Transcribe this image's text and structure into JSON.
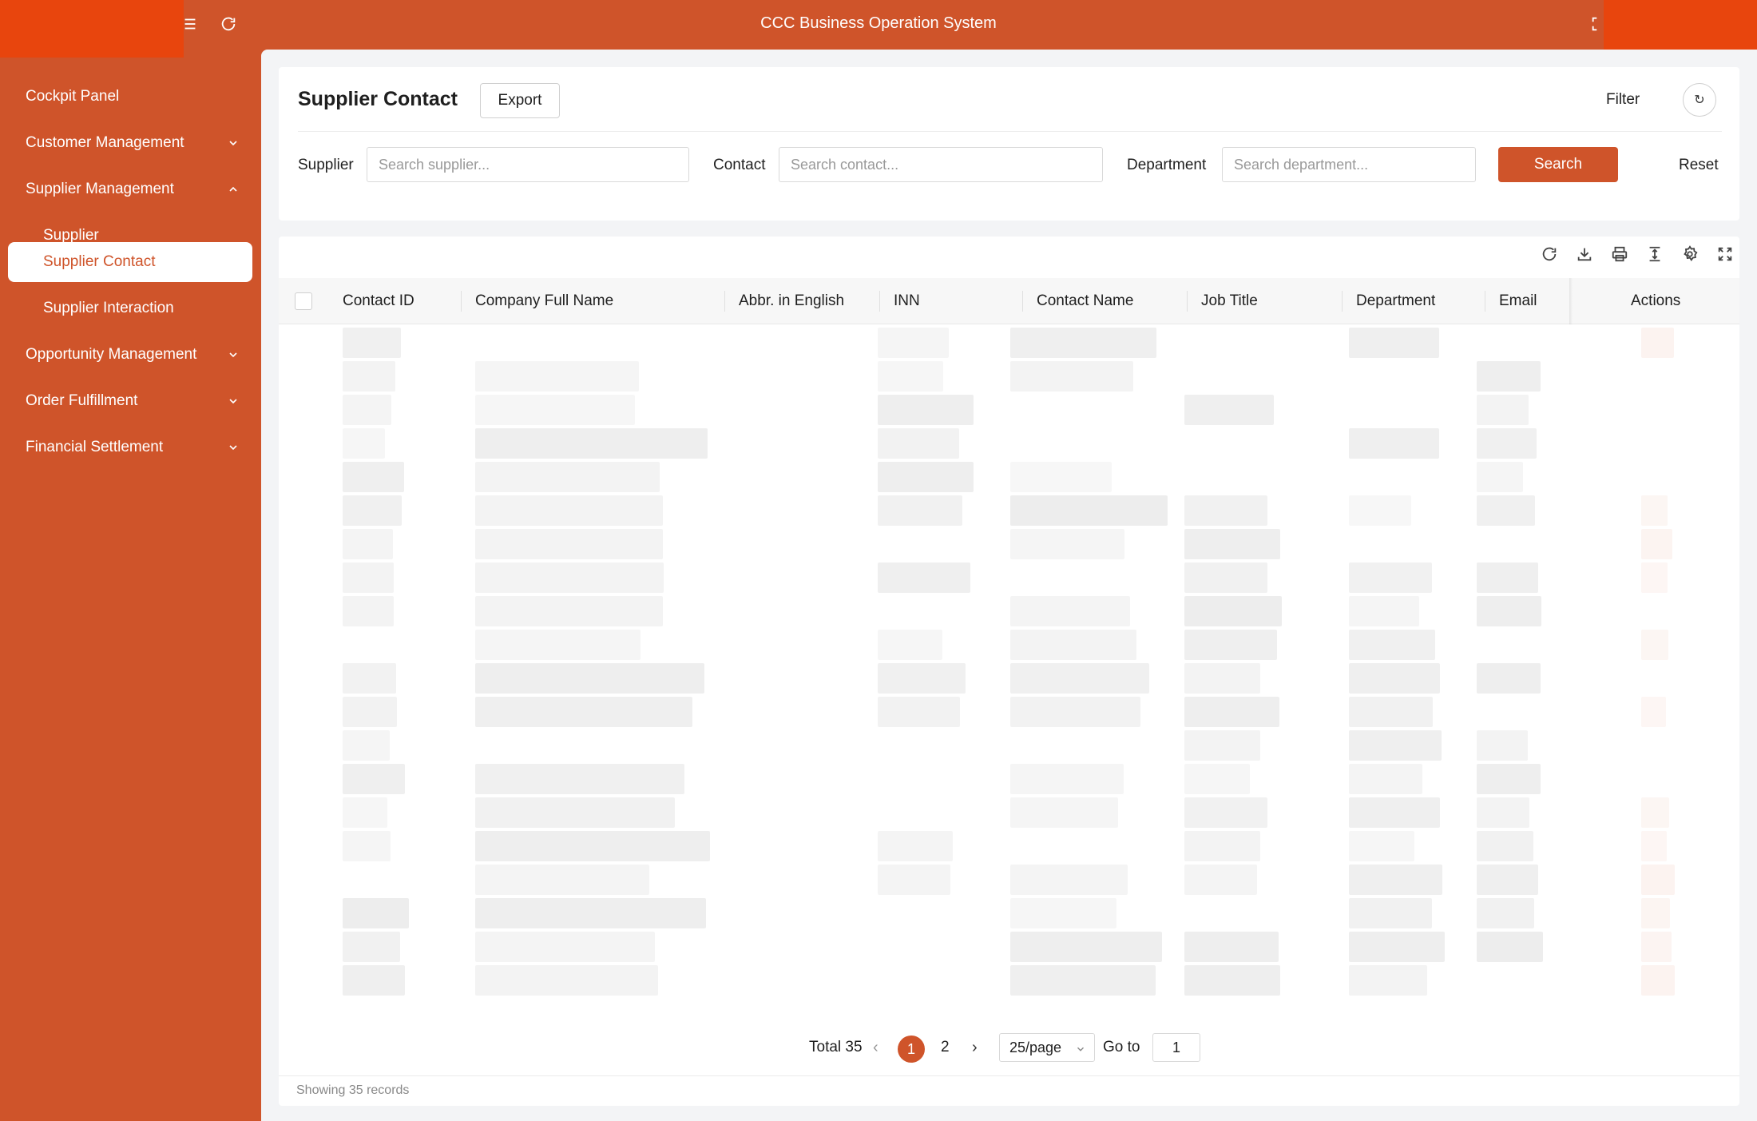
{
  "app": {
    "title": "CCC Business Operation System"
  },
  "colors": {
    "brand": "#cf542a",
    "brand_bright": "#e8450d"
  },
  "icons": {
    "menu": "menu-icon",
    "refresh": "refresh-icon",
    "fullscreen": "fullscreen-icon"
  },
  "sidebar": {
    "items": [
      {
        "label": "Cockpit Panel"
      },
      {
        "label": "Customer Management"
      },
      {
        "label": "Supplier Management"
      },
      {
        "label": "Supplier"
      },
      {
        "label": "Supplier Contact"
      },
      {
        "label": "Supplier Interaction"
      },
      {
        "label": "Opportunity Management"
      },
      {
        "label": "Order Fulfillment"
      },
      {
        "label": "Financial Settlement"
      }
    ]
  },
  "page": {
    "title": "Supplier Contact",
    "export_label": "Export",
    "filter_label": "Filter",
    "reset_glyph": "↻"
  },
  "filters": {
    "supplier_label": "Supplier",
    "supplier_placeholder": "Search supplier...",
    "contact_label": "Contact",
    "contact_placeholder": "Search contact...",
    "department_label": "Department",
    "department_placeholder": "Search department...",
    "search_label": "Search",
    "reset_label": "Reset"
  },
  "table": {
    "columns": [
      "Contact ID",
      "Company Full Name",
      "Abbr. in English",
      "INN",
      "Contact Name",
      "Job Title",
      "Department",
      "Email",
      "Actions"
    ]
  },
  "pagination": {
    "total_text": "Total 35",
    "pages": [
      "1",
      "2"
    ],
    "current_page": "1",
    "page_size": "25/page",
    "goto_label": "Go to",
    "goto_value": "1"
  },
  "footer": {
    "text": "Showing 35 records"
  }
}
